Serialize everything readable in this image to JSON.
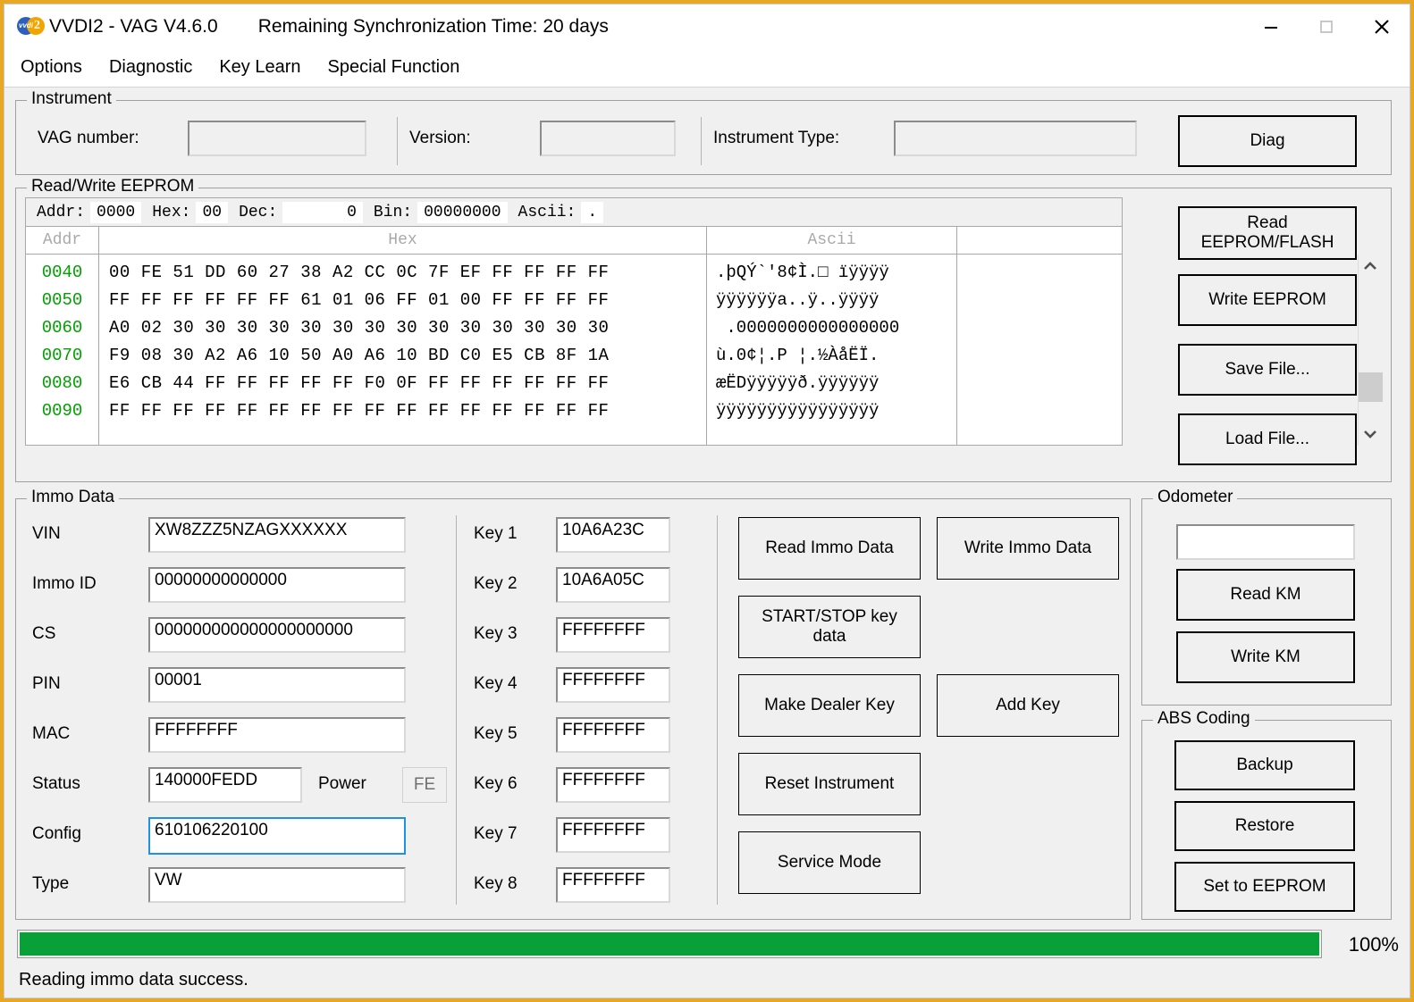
{
  "window": {
    "title": "VVDI2 - VAG V4.6.0",
    "sync_label": "Remaining Synchronization Time: 20 days",
    "logo_text_1": "vvdi",
    "logo_text_2": "2",
    "accent_border": "#e8a825",
    "controls": {
      "minimize": "minimize-icon",
      "maximize": "maximize-icon",
      "close": "close-icon"
    }
  },
  "menu": {
    "items": [
      {
        "label": "Options"
      },
      {
        "label": "Diagnostic"
      },
      {
        "label": "Key Learn"
      },
      {
        "label": "Special Function"
      }
    ]
  },
  "instrument": {
    "title": "Instrument",
    "vag_number_label": "VAG number:",
    "vag_number_value": "",
    "version_label": "Version:",
    "version_value": "",
    "instrument_type_label": "Instrument Type:",
    "instrument_type_value": "",
    "diag_button": "Diag"
  },
  "eeprom": {
    "title": "Read/Write EEPROM",
    "info": {
      "addr_label": "Addr:",
      "addr_value": "0000",
      "hex_label": "Hex:",
      "hex_value": "00",
      "dec_label": "Dec:",
      "dec_value": "      0",
      "bin_label": "Bin:",
      "bin_value": "00000000",
      "ascii_label": "Ascii:",
      "ascii_value": "."
    },
    "columns": {
      "addr": "Addr",
      "hex": "Hex",
      "ascii": "Ascii"
    },
    "rows": [
      {
        "addr": "0040",
        "hex": "00 FE 51 DD 60 27 38 A2 CC 0C 7F EF FF FF FF FF",
        "ascii": ".þQÝ`'8¢Ì.□ ïÿÿÿÿ"
      },
      {
        "addr": "0050",
        "hex": "FF FF FF FF FF FF 61 01 06 FF 01 00 FF FF FF FF",
        "ascii": "ÿÿÿÿÿÿa..ÿ..ÿÿÿÿ"
      },
      {
        "addr": "0060",
        "hex": "A0 02 30 30 30 30 30 30 30 30 30 30 30 30 30 30",
        "ascii": " .0000000000000000"
      },
      {
        "addr": "0070",
        "hex": "F9 08 30 A2 A6 10 50 A0 A6 10 BD C0 E5 CB 8F 1A",
        "ascii": "ù.0¢¦.P ¦.½ÀåËÏ."
      },
      {
        "addr": "0080",
        "hex": "E6 CB 44 FF FF FF FF FF F0 0F FF FF FF FF FF FF",
        "ascii": "æËDÿÿÿÿÿð.ÿÿÿÿÿÿ"
      },
      {
        "addr": "0090",
        "hex": "FF FF FF FF FF FF FF FF FF FF FF FF FF FF FF FF",
        "ascii": "ÿÿÿÿÿÿÿÿÿÿÿÿÿÿÿÿ"
      }
    ],
    "buttons": [
      {
        "label": "Read\nEEPROM/FLASH",
        "name": "read-eeprom-flash-button"
      },
      {
        "label": "Write EEPROM",
        "name": "write-eeprom-button"
      },
      {
        "label": "Save File...",
        "name": "save-file-button"
      },
      {
        "label": "Load File...",
        "name": "load-file-button"
      }
    ],
    "scrollbar": {
      "up": "chevron-up-icon",
      "down": "chevron-down-icon"
    }
  },
  "immo": {
    "title": "Immo Data",
    "fields": [
      {
        "label": "VIN",
        "value": "XW8ZZZ5NZAGXXXXXX"
      },
      {
        "label": "Immo ID",
        "value": "00000000000000"
      },
      {
        "label": "CS",
        "value": "000000000000000000000"
      },
      {
        "label": "PIN",
        "value": "00001"
      },
      {
        "label": "MAC",
        "value": "FFFFFFFF"
      },
      {
        "label": "Status",
        "value": "140000FEDD"
      },
      {
        "label": "Config",
        "value": "610106220100"
      },
      {
        "label": "Type",
        "value": "VW"
      }
    ],
    "power_label": "Power",
    "power_value": "FE",
    "keys": [
      {
        "label": "Key 1",
        "value": "10A6A23C"
      },
      {
        "label": "Key 2",
        "value": "10A6A05C"
      },
      {
        "label": "Key 3",
        "value": "FFFFFFFF"
      },
      {
        "label": "Key 4",
        "value": "FFFFFFFF"
      },
      {
        "label": "Key 5",
        "value": "FFFFFFFF"
      },
      {
        "label": "Key 6",
        "value": "FFFFFFFF"
      },
      {
        "label": "Key 7",
        "value": "FFFFFFFF"
      },
      {
        "label": "Key 8",
        "value": "FFFFFFFF"
      }
    ],
    "actions": [
      {
        "label": "Read Immo Data",
        "name": "read-immo-data-button"
      },
      {
        "label": "Write Immo Data",
        "name": "write-immo-data-button"
      },
      {
        "label": "START/STOP key\ndata",
        "name": "start-stop-key-data-button"
      },
      {
        "label": "Make Dealer Key",
        "name": "make-dealer-key-button"
      },
      {
        "label": "Add Key",
        "name": "add-key-button"
      },
      {
        "label": "Reset Instrument",
        "name": "reset-instrument-button"
      },
      {
        "label": "Service Mode",
        "name": "service-mode-button"
      }
    ]
  },
  "odometer": {
    "title": "Odometer",
    "value": "",
    "read_km": "Read KM",
    "write_km": "Write KM"
  },
  "abs_coding": {
    "title": "ABS Coding",
    "backup": "Backup",
    "restore": "Restore",
    "set_to_eeprom": "Set to EEPROM"
  },
  "progress": {
    "percent": 100,
    "percent_label": "100%",
    "fill_color": "#09a03a"
  },
  "status": {
    "message": "Reading immo data success."
  }
}
